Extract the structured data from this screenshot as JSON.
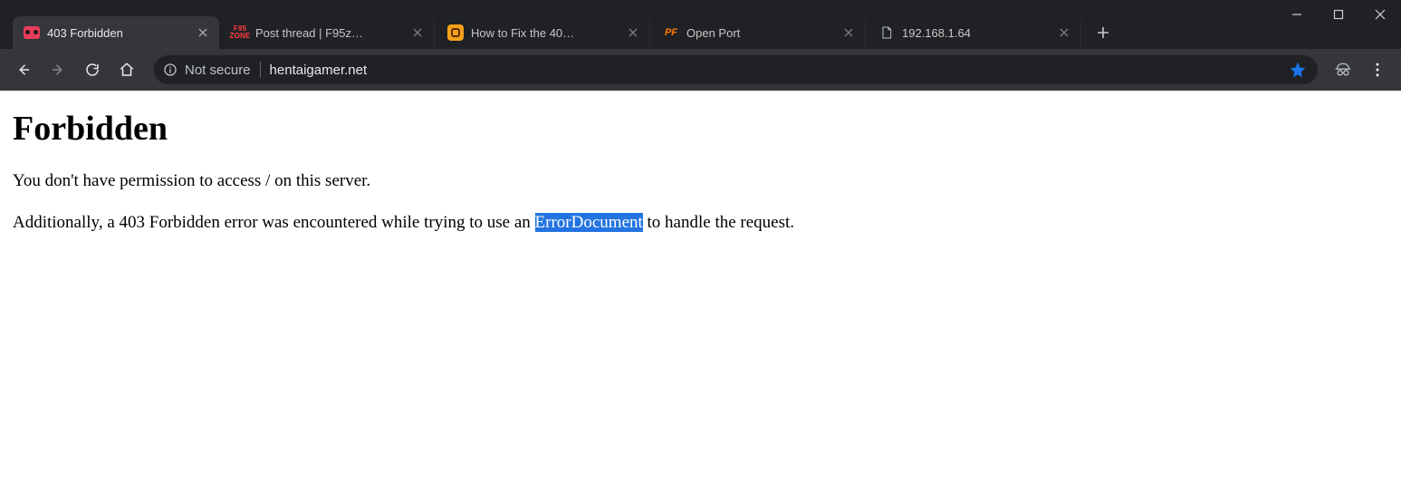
{
  "window": {
    "tabs": [
      {
        "title": "403 Forbidden",
        "active": true
      },
      {
        "title": "Post thread | F95z…",
        "active": false
      },
      {
        "title": "How to Fix the 40…",
        "active": false
      },
      {
        "title": "Open Port",
        "active": false
      },
      {
        "title": "192.168.1.64",
        "active": false
      }
    ]
  },
  "toolbar": {
    "security_label": "Not secure",
    "url": "hentaigamer.net"
  },
  "page": {
    "heading": "Forbidden",
    "p1": "You don't have permission to access / on this server.",
    "p2_a": "Additionally, a 403 Forbidden error was encountered while trying to use an ",
    "p2_b": "ErrorDocument",
    "p2_c": " to handle the request."
  }
}
